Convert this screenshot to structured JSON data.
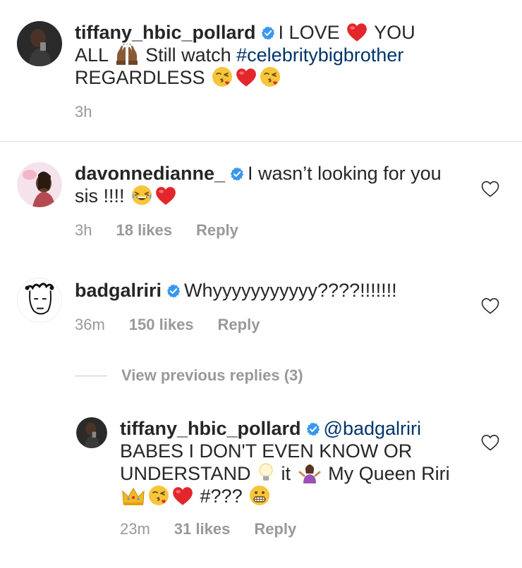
{
  "caption": {
    "username": "tiffany_hbic_pollard",
    "text_parts": [
      "I LOVE",
      "YOU ALL",
      "Still watch",
      "#celebritybigbrother",
      "REGARDLESS"
    ],
    "time": "3h"
  },
  "comments": [
    {
      "username": "davonnedianne_",
      "text_parts": [
        "I wasn’t looking for you sis !!!!"
      ],
      "time": "3h",
      "likes": "18 likes",
      "reply": "Reply"
    },
    {
      "username": "badgalriri",
      "text_parts": [
        "Whyyyyyyyyyyy????!!!!!!!"
      ],
      "time": "36m",
      "likes": "150 likes",
      "reply": "Reply"
    }
  ],
  "view_previous_replies": "View previous replies (3)",
  "reply": {
    "username": "tiffany_hbic_pollard",
    "mention": "@badgalriri",
    "text_parts": [
      "BABES I DON'T EVEN KNOW OR UNDERSTAND",
      "it",
      "My Queen Riri",
      "#???"
    ],
    "time": "23m",
    "likes": "31 likes",
    "reply": "Reply"
  },
  "colors": {
    "verified_blue": "#3897f0",
    "hashtag_blue": "#003569",
    "meta_gray": "#999999",
    "heart_red": "#e3262c"
  },
  "icons": [
    "verified-badge-icon",
    "heart-outline-icon",
    "red-heart-emoji",
    "raised-hands-emoji",
    "kissing-face-emoji",
    "crying-laughing-emoji",
    "lightbulb-emoji",
    "shrug-emoji",
    "crown-emoji",
    "grimacing-emoji"
  ]
}
